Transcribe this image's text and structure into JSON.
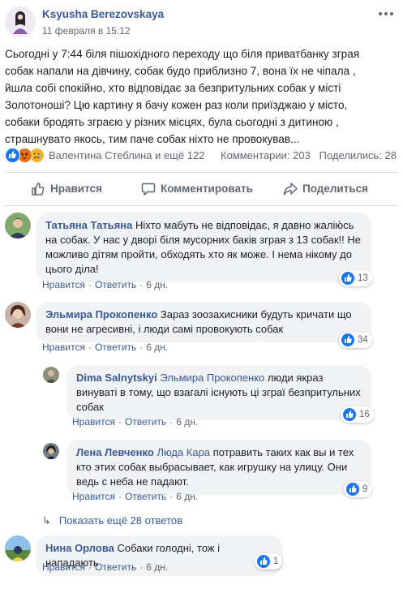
{
  "post": {
    "author": "Ksyusha Berezovskaya",
    "date": "11 февраля в 15:12",
    "more_icon": "ellipsis-icon",
    "text_lines": [
      "Сьогодні у 7:44 біля пішохідного переходу що біля приватбанку зграя",
      "собак напали на дівчину, собак будо приблизно 7, вона їх не чіпала ,",
      "йшла собі спокійно, хто відповідає за безпритульних собак у місті",
      "Золотоноші? Цю картину я бачу кожен раз коли приїзджаю у місто,",
      "собаки бродять зграєю у різних місцях, була сьогодні з дитиною ,",
      "страшнувато якось, тим паче собак ніхто не провокував..."
    ],
    "reactions": [
      "like",
      "angry",
      "sad"
    ],
    "reacted_by": "Валентина Стеблина и ещё 122",
    "comments_count": "Комментарии: 203",
    "shares_count": "Поделились: 28"
  },
  "actions": {
    "like": "Нравится",
    "comment": "Комментировать",
    "share": "Поделиться"
  },
  "colors": {
    "link": "#385898",
    "like_blue": "#1877f2",
    "bubble_bg": "#f2f3f5",
    "meta_gray": "#606770"
  },
  "comments": [
    {
      "name": "Татьяна Татьяна",
      "lines": [
        "Ніхто мабуть не відповідає, я давно жалію́сь",
        "на собак. У нас у дворі біля мусорних баків зграя з 13 собак!! Не",
        "можливо дітям пройти, обходять хто як може. І нема нікому до",
        "цього діла!"
      ],
      "like": "Нравится",
      "reply": "Ответить",
      "time": "6 дн.",
      "likes": "13"
    },
    {
      "name": "Эльмира Прокопенко",
      "lines": [
        "Зараз зоозахисники будуть кричати що",
        "вони не агресивні, і люди самі провокують собак"
      ],
      "like": "Нравится",
      "reply": "Ответить",
      "time": "6 дн.",
      "likes": "34"
    },
    {
      "name": "Dima Salnytskyi",
      "mention": "Эльмира Прокопенко",
      "lines": [
        "люди якраз",
        "винуваті в тому, що взагалі існують ці зграї безпритульних",
        "собак"
      ],
      "like": "Нравится",
      "reply": "Ответить",
      "time": "6 дн.",
      "likes": "16"
    },
    {
      "name": "Лена Левченко",
      "mention": "Люда Кара",
      "lines": [
        "потравить таких как вы и тех",
        "кто этих собак выбрасывает, как игрушку на улицу. Они",
        "ведь с неба не падают."
      ],
      "like": "Нравится",
      "reply": "Ответить",
      "time": "6 дн.",
      "likes": "9"
    },
    {
      "name": "Нина Орлова",
      "lines": [
        "Собаки голодні, тож і нападають"
      ],
      "like": "Нравится",
      "reply": "Ответить",
      "time": "6 дн.",
      "likes": "1"
    }
  ],
  "more_replies": "Показать ещё 28 ответов"
}
